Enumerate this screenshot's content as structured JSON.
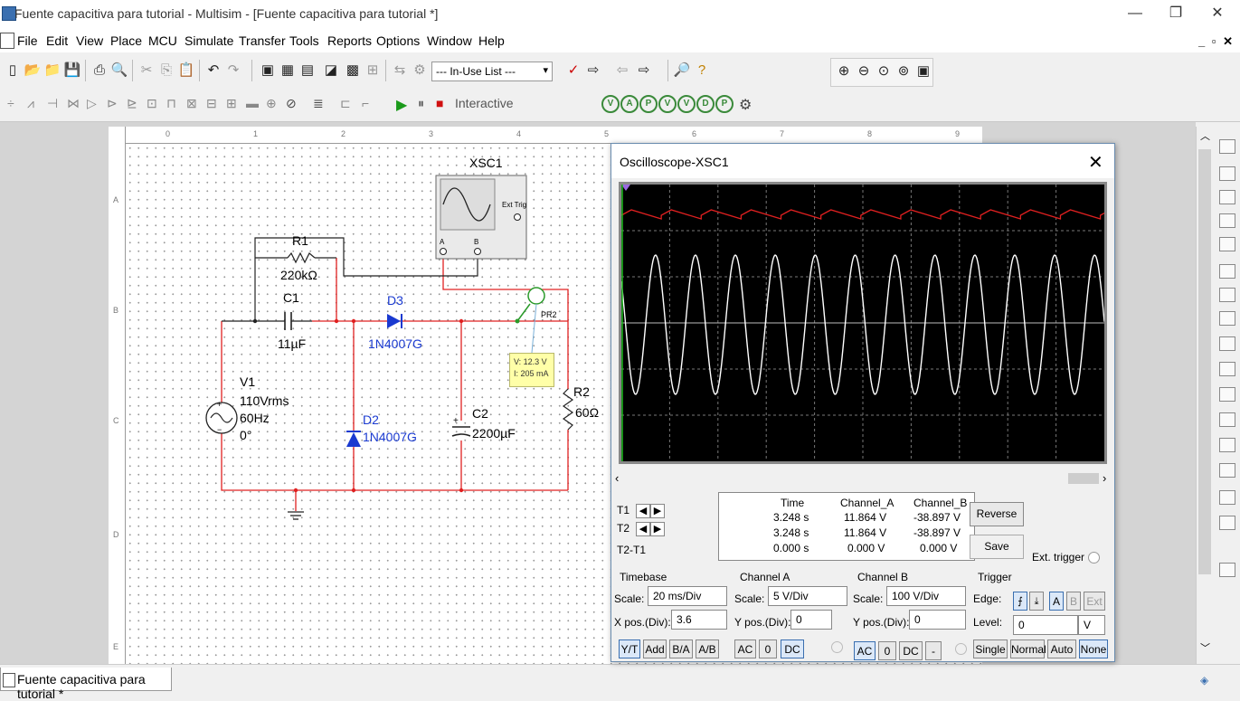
{
  "window": {
    "title": "Fuente capacitiva para tutorial - Multisim - [Fuente capacitiva para tutorial *]",
    "minimize": "—",
    "restore": "❐",
    "close": "✕"
  },
  "menu": {
    "items": [
      "File",
      "Edit",
      "View",
      "Place",
      "MCU",
      "Simulate",
      "Transfer",
      "Tools",
      "Reports",
      "Options",
      "Window",
      "Help"
    ],
    "mdi_controls": "_ ▫ ✕"
  },
  "toolbar": {
    "in_use_list": "--- In-Use List ---",
    "interactive_label": "Interactive"
  },
  "ruler": {
    "top_numbers": [
      "0",
      "1",
      "2",
      "3",
      "4",
      "5",
      "6",
      "7",
      "8",
      "9"
    ],
    "left_letters": [
      "A",
      "B",
      "C",
      "D",
      "E"
    ]
  },
  "circuit": {
    "scope_label": "XSC1",
    "scope_ext_trig": "Ext Trig",
    "scope_ch_a": "A",
    "scope_ch_b": "B",
    "r1_name": "R1",
    "r1_value": "220kΩ",
    "c1_name": "C1",
    "c1_value": "11µF",
    "d3_name": "D3",
    "d3_value": "1N4007G",
    "d2_name": "D2",
    "d2_value": "1N4007G",
    "c2_name": "C2",
    "c2_value": "2200µF",
    "r2_name": "R2",
    "r2_value": "60Ω",
    "v1_name": "V1",
    "v1_amp": "110Vrms",
    "v1_freq": "60Hz",
    "v1_phase": "0°",
    "probe_name": "PR2",
    "probe_voltage": "V: 12.3 V",
    "probe_current": "I: 205 mA"
  },
  "oscilloscope": {
    "title": "Oscilloscope-XSC1",
    "close": "✕",
    "readout": {
      "headers": [
        "Time",
        "Channel_A",
        "Channel_B"
      ],
      "rows": [
        {
          "label": "T1",
          "time": "3.248 s",
          "ch_a": "11.864 V",
          "ch_b": "-38.897 V"
        },
        {
          "label": "T2",
          "time": "3.248 s",
          "ch_a": "11.864 V",
          "ch_b": "-38.897 V"
        },
        {
          "label": "T2-T1",
          "time": "0.000 s",
          "ch_a": "0.000 V",
          "ch_b": "0.000 V"
        }
      ]
    },
    "reverse_button": "Reverse",
    "save_button": "Save",
    "ext_trigger_label": "Ext. trigger",
    "timebase": {
      "title": "Timebase",
      "scale_label": "Scale:",
      "scale_value": "20 ms/Div",
      "xpos_label": "X pos.(Div):",
      "xpos_value": "3.6",
      "buttons": [
        "Y/T",
        "Add",
        "B/A",
        "A/B"
      ]
    },
    "channel_a": {
      "title": "Channel A",
      "scale_label": "Scale:",
      "scale_value": "5  V/Div",
      "ypos_label": "Y pos.(Div):",
      "ypos_value": "0",
      "buttons": [
        "AC",
        "0",
        "DC"
      ]
    },
    "channel_b": {
      "title": "Channel B",
      "scale_label": "Scale:",
      "scale_value": "100  V/Div",
      "ypos_label": "Y pos.(Div):",
      "ypos_value": "0",
      "buttons": [
        "AC",
        "0",
        "DC",
        "-"
      ]
    },
    "trigger": {
      "title": "Trigger",
      "edge_label": "Edge:",
      "edge_buttons": [
        "A",
        "B",
        "Ext"
      ],
      "level_label": "Level:",
      "level_value": "0",
      "level_unit": "V",
      "mode_buttons": [
        "Single",
        "Normal",
        "Auto",
        "None"
      ]
    },
    "trace_colors": {
      "channel_a": "#e02020",
      "channel_b": "#ffffff"
    }
  },
  "tab": {
    "document": "Fuente capacitiva para tutorial *"
  }
}
